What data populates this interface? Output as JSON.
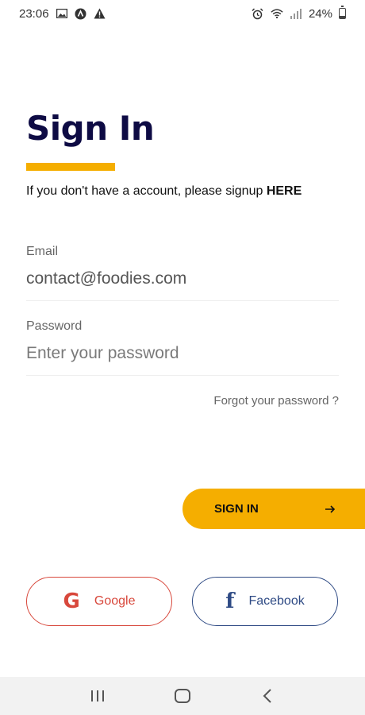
{
  "status_bar": {
    "time": "23:06",
    "battery_text": "24%",
    "battery_level": 0.24,
    "icons_left": [
      "image-icon",
      "app-icon",
      "warning-icon"
    ],
    "icons_right": [
      "alarm-icon",
      "wifi-icon",
      "signal-icon",
      "battery-icon"
    ]
  },
  "header": {
    "title": "Sign In",
    "subtitle": "If you don't have a account, please signup ",
    "subtitle_link": "HERE"
  },
  "form": {
    "email_label": "Email",
    "email_value": "contact@foodies.com",
    "password_label": "Password",
    "password_placeholder": "Enter your password",
    "forgot_link": "Forgot your password ?"
  },
  "actions": {
    "signin_label": "SIGN IN",
    "google_label": "Google",
    "facebook_label": "Facebook"
  },
  "colors": {
    "accent": "#f5ae00",
    "title": "#0e0b44",
    "google": "#d8483c",
    "facebook": "#2e4a84"
  },
  "nav_bar": {
    "buttons": [
      "recents-icon",
      "home-icon",
      "back-icon"
    ]
  }
}
